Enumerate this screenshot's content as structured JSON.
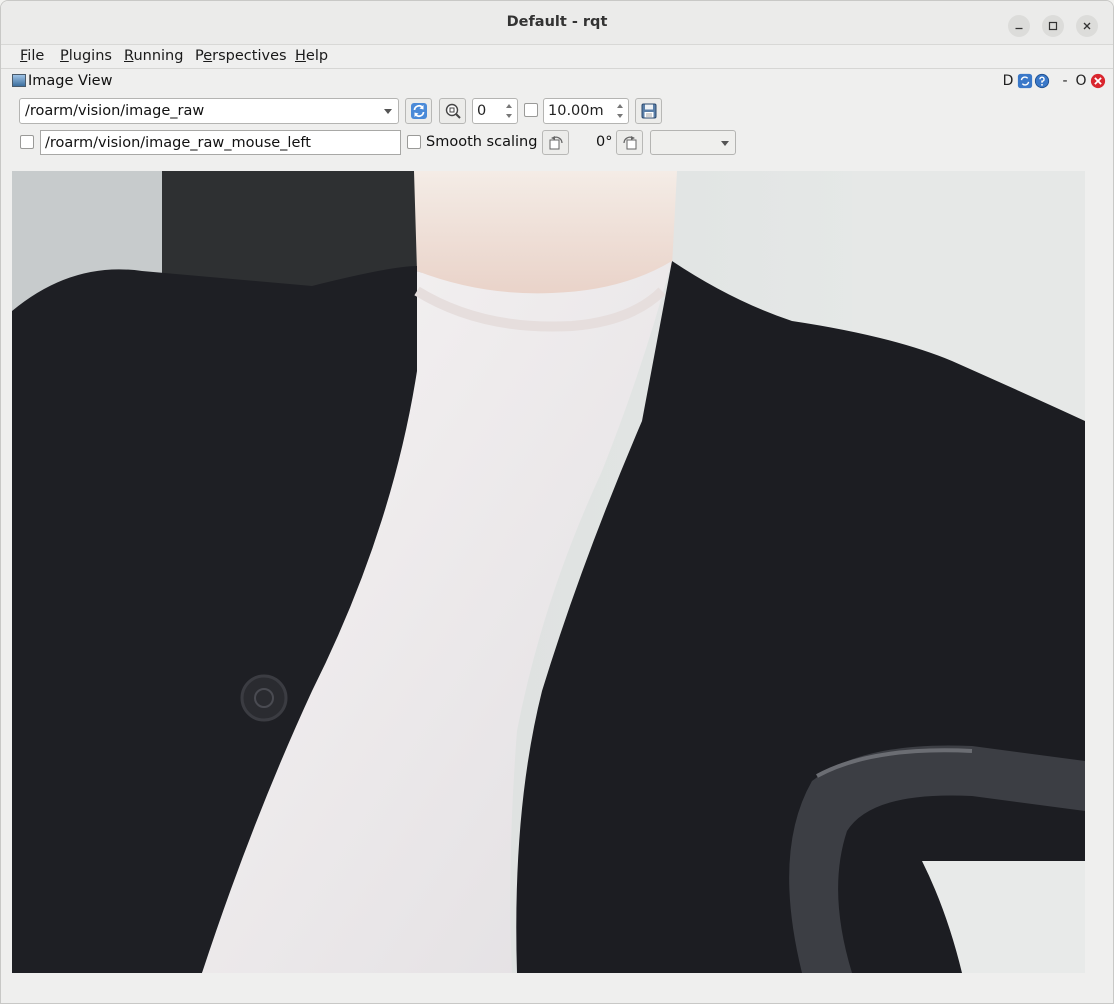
{
  "window": {
    "title": "Default - rqt"
  },
  "menu": [
    {
      "label": "File",
      "accel": "F",
      "rest": "ile"
    },
    {
      "label": "Plugins",
      "accel": "P",
      "rest": "lugins"
    },
    {
      "label": "Running",
      "accel": "R",
      "rest": "unning"
    },
    {
      "label": "Perspectives",
      "pre": "P",
      "accel": "e",
      "rest": "rspectives"
    },
    {
      "label": "Help",
      "accel": "H",
      "rest": "elp"
    }
  ],
  "plugin": {
    "title": "Image View",
    "header_buttons": {
      "dock": "D",
      "minimize": "-",
      "float": "O"
    }
  },
  "toolbar": {
    "topic": "/roarm/vision/image_raw",
    "spin_value": "0",
    "max_value": "10.00m",
    "mouse_topic": "/roarm/vision/image_raw_mouse_left",
    "smooth_scaling_label": "Smooth scaling",
    "rotation_label": "0°",
    "colormap": ""
  },
  "icons": {
    "refresh": "refresh-icon",
    "zoom": "zoom-fit-icon",
    "save": "save-image-icon",
    "rotate_left": "rotate-left-icon",
    "rotate_right": "rotate-right-icon",
    "help": "help-icon",
    "close": "close-icon"
  },
  "colors": {
    "accent": "#3584e4",
    "close_red": "#d9262e"
  }
}
